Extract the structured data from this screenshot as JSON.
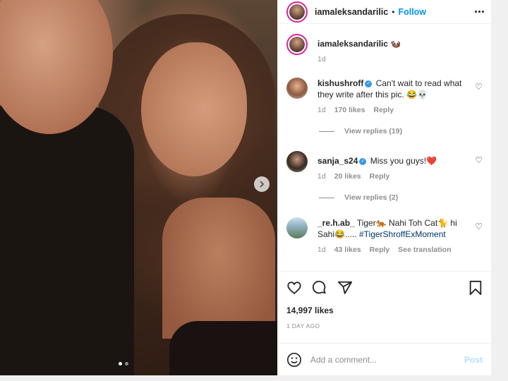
{
  "post": {
    "username": "iamaleksandarilic",
    "separator": "•",
    "follow_label": "Follow",
    "caption_emoji": "🦦",
    "caption_time": "1d",
    "likes": "14,997 likes",
    "posted": "1 DAY AGO",
    "comment_placeholder": "Add a comment...",
    "post_label": "Post"
  },
  "comments": [
    {
      "user": "kishushroff",
      "text": "Can't wait to read what they write after this pic. 😂💀",
      "time": "1d",
      "likes": "170 likes",
      "reply": "Reply",
      "view_replies": "View replies (19)"
    },
    {
      "user": "sanja_s24",
      "text": "Miss you guys!❤️",
      "time": "1d",
      "likes": "20 likes",
      "reply": "Reply",
      "view_replies": "View replies (2)"
    },
    {
      "user": "_re.h.ab_",
      "text": "Tiger🐅 Nahi Toh Cat🐈 hi Sahi😂.....",
      "hashtag": "#TigerShroffExMoment",
      "time": "1d",
      "likes": "43 likes",
      "reply": "Reply",
      "translation": "See translation"
    }
  ],
  "carousel": {
    "count": 2,
    "active": 1
  },
  "colors": {
    "link": "#0095f6",
    "verified": "#3897f0",
    "muted": "#8e8e8e",
    "text": "#262626"
  },
  "icons": [
    "more-icon",
    "heart-icon",
    "comment-icon",
    "share-icon",
    "bookmark-icon",
    "emoji-icon",
    "chevron-right-icon",
    "verified-icon"
  ]
}
